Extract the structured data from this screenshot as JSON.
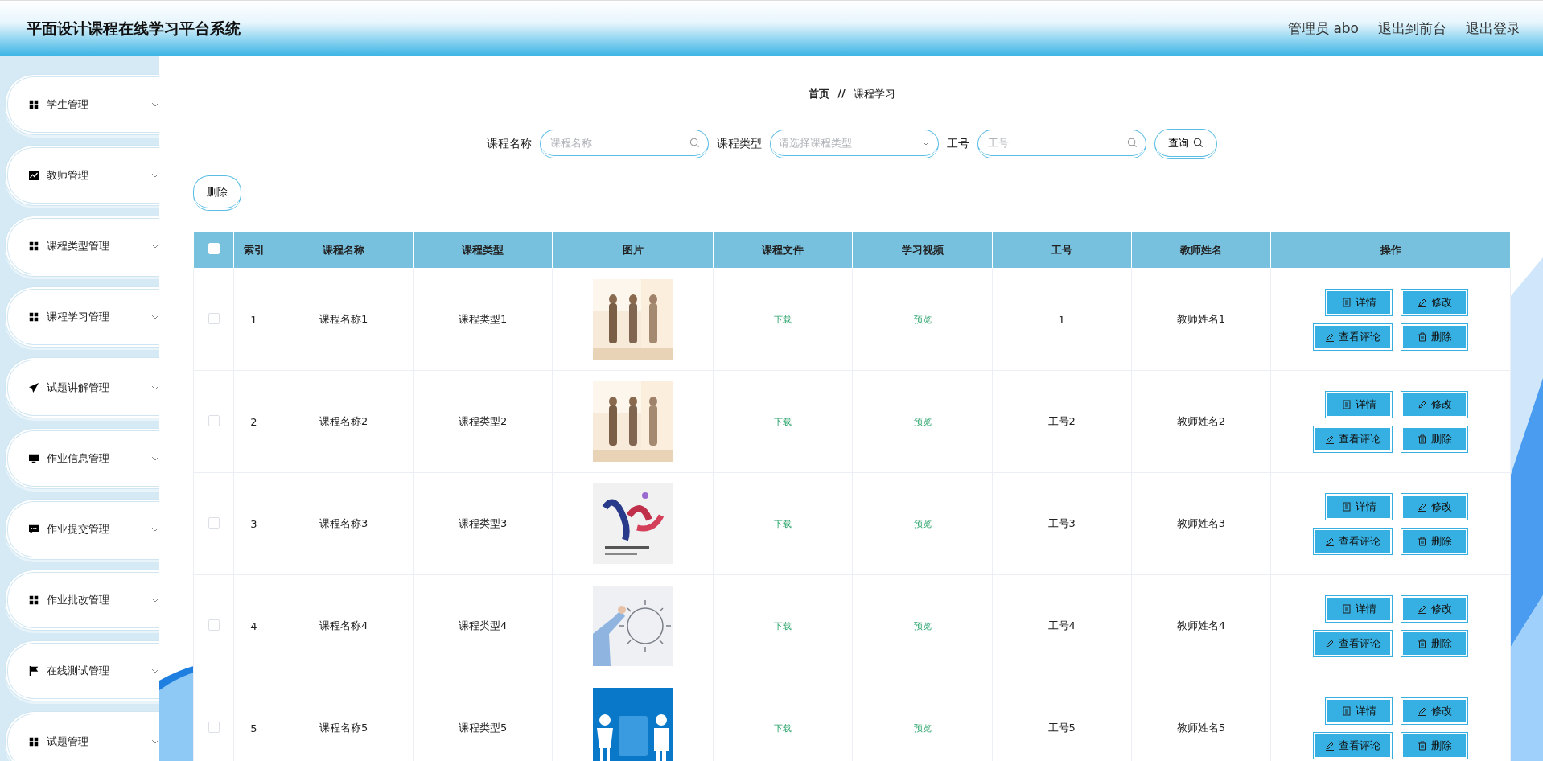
{
  "header": {
    "title": "平面设计课程在线学习平台系统",
    "links": [
      "管理员 abo",
      "退出到前台",
      "退出登录"
    ]
  },
  "sidebar": {
    "items": [
      {
        "label": "学生管理"
      },
      {
        "label": "教师管理"
      },
      {
        "label": "课程类型管理"
      },
      {
        "label": "课程学习管理"
      },
      {
        "label": "试题讲解管理"
      },
      {
        "label": "作业信息管理"
      },
      {
        "label": "作业提交管理"
      },
      {
        "label": "作业批改管理"
      },
      {
        "label": "在线测试管理"
      },
      {
        "label": "试题管理"
      }
    ]
  },
  "breadcrumb": {
    "home": "首页",
    "separator": "//",
    "current": "课程学习"
  },
  "search": {
    "fields": [
      {
        "kind": "input",
        "label": "课程名称",
        "placeholder": "课程名称"
      },
      {
        "kind": "select",
        "label": "课程类型",
        "placeholder": "请选择课程类型"
      },
      {
        "kind": "input",
        "label": "工号",
        "placeholder": "工号"
      }
    ],
    "button": "查询"
  },
  "toolbar": {
    "delete_button": "删除"
  },
  "table": {
    "select_all": {
      "checked": false
    },
    "columns": [
      "索引",
      "课程名称",
      "课程类型",
      "图片",
      "课程文件",
      "学习视频",
      "工号",
      "教师姓名",
      "操作"
    ],
    "rows": [
      {
        "checked": false,
        "index": "1",
        "name": "课程名称1",
        "type": "课程类型1",
        "picture": {
          "kind": "picture"
        },
        "file": "下载",
        "video": "预览",
        "staff_no": "1",
        "teacher": "教师姓名1",
        "actions": [
          "详情",
          "修改",
          "查看评论",
          "删除"
        ]
      },
      {
        "checked": false,
        "index": "2",
        "name": "课程名称2",
        "type": "课程类型2",
        "picture": {
          "kind": "picture"
        },
        "file": "下载",
        "video": "预览",
        "staff_no": "工号2",
        "teacher": "教师姓名2",
        "actions": [
          "详情",
          "修改",
          "查看评论",
          "删除"
        ]
      },
      {
        "checked": false,
        "index": "3",
        "name": "课程名称3",
        "type": "课程类型3",
        "picture": {
          "kind": "picture"
        },
        "file": "下载",
        "video": "预览",
        "staff_no": "工号3",
        "teacher": "教师姓名3",
        "actions": [
          "详情",
          "修改",
          "查看评论",
          "删除"
        ]
      },
      {
        "checked": false,
        "index": "4",
        "name": "课程名称4",
        "type": "课程类型4",
        "picture": {
          "kind": "picture"
        },
        "file": "下载",
        "video": "预览",
        "staff_no": "工号4",
        "teacher": "教师姓名4",
        "actions": [
          "详情",
          "修改",
          "查看评论",
          "删除"
        ]
      },
      {
        "checked": false,
        "index": "5",
        "name": "课程名称5",
        "type": "课程类型5",
        "picture": {
          "kind": "picture"
        },
        "file": "下载",
        "video": "预览",
        "staff_no": "工号5",
        "teacher": "教师姓名5",
        "actions": [
          "详情",
          "修改",
          "查看评论",
          "删除"
        ]
      }
    ]
  }
}
